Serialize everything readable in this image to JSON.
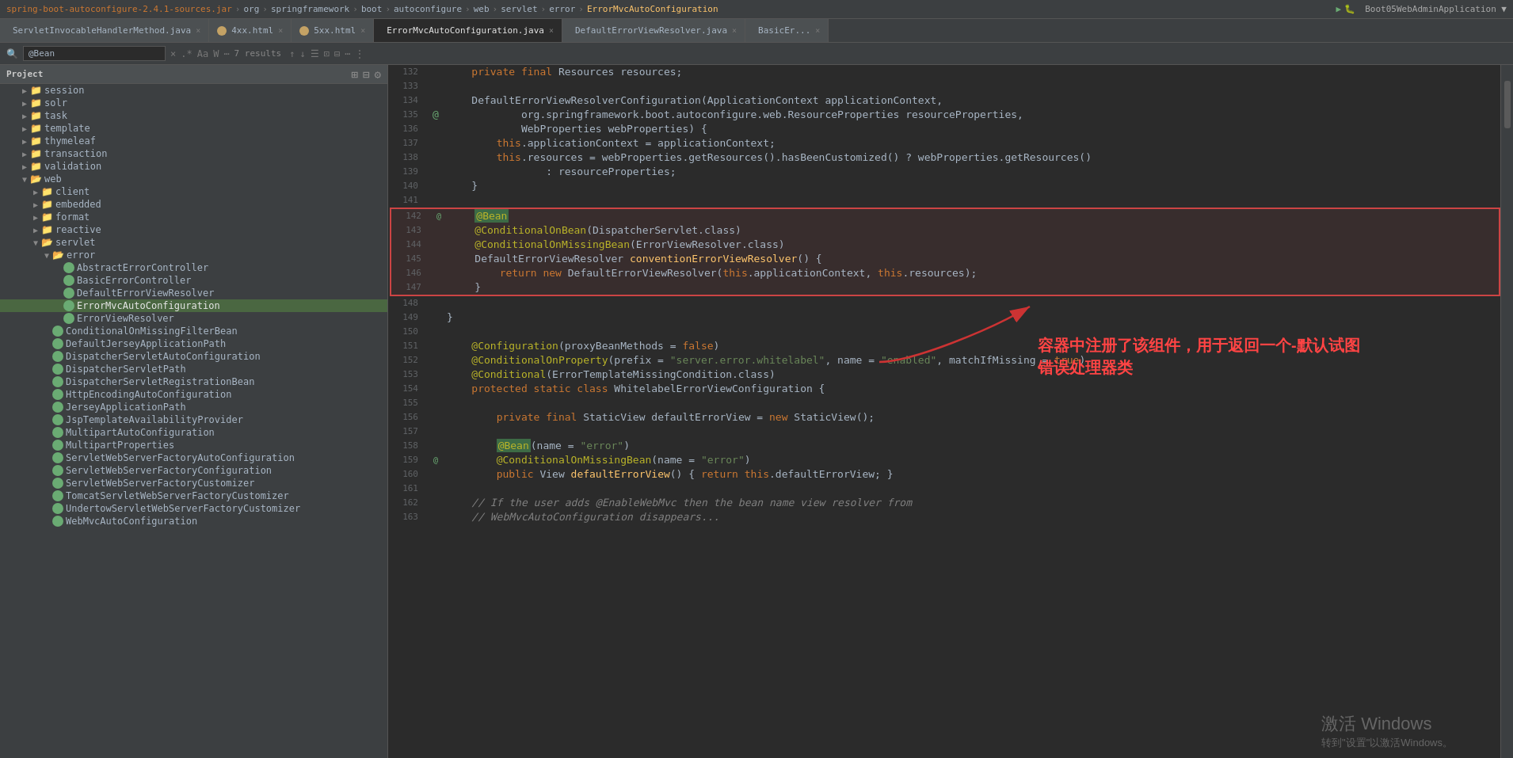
{
  "breadcrumb": {
    "items": [
      "spring-boot-autoconfigure-2.4.1-sources.jar",
      "org",
      "springframework",
      "boot",
      "autoconfigure",
      "web",
      "servlet",
      "error",
      "ErrorMvcAutoConfiguration"
    ],
    "separator": "›"
  },
  "tabs": [
    {
      "label": "ServletInvocableHandlerMethod.java",
      "icon": "orange",
      "active": false
    },
    {
      "label": "4xx.html",
      "icon": "orange",
      "active": false
    },
    {
      "label": "5xx.html",
      "icon": "orange",
      "active": false
    },
    {
      "label": "ErrorMvcAutoConfiguration.java",
      "icon": "green",
      "active": true
    },
    {
      "label": "DefaultErrorViewResolver.java",
      "icon": "green",
      "active": false
    },
    {
      "label": "BasicEr...",
      "icon": "green",
      "active": false
    }
  ],
  "search": {
    "query": "@Bean",
    "results": "7 results"
  },
  "sidebar": {
    "title": "Project",
    "tree_items": [
      {
        "label": "session",
        "type": "folder",
        "indent": 1,
        "expanded": false
      },
      {
        "label": "solr",
        "type": "folder",
        "indent": 1,
        "expanded": false
      },
      {
        "label": "task",
        "type": "folder",
        "indent": 1,
        "expanded": false
      },
      {
        "label": "template",
        "type": "folder",
        "indent": 1,
        "expanded": false
      },
      {
        "label": "thymeleaf",
        "type": "folder",
        "indent": 1,
        "expanded": false
      },
      {
        "label": "transaction",
        "type": "folder",
        "indent": 1,
        "expanded": false
      },
      {
        "label": "validation",
        "type": "folder",
        "indent": 1,
        "expanded": false
      },
      {
        "label": "web",
        "type": "folder",
        "indent": 1,
        "expanded": true
      },
      {
        "label": "client",
        "type": "folder",
        "indent": 2,
        "expanded": false
      },
      {
        "label": "embedded",
        "type": "folder",
        "indent": 2,
        "expanded": false
      },
      {
        "label": "format",
        "type": "folder",
        "indent": 2,
        "expanded": false
      },
      {
        "label": "reactive",
        "type": "folder",
        "indent": 2,
        "expanded": false
      },
      {
        "label": "servlet",
        "type": "folder",
        "indent": 2,
        "expanded": true
      },
      {
        "label": "error",
        "type": "folder",
        "indent": 3,
        "expanded": true
      },
      {
        "label": "AbstractErrorController",
        "type": "file",
        "indent": 4,
        "icon": "green"
      },
      {
        "label": "BasicErrorController",
        "type": "file",
        "indent": 4,
        "icon": "green"
      },
      {
        "label": "DefaultErrorViewResolver",
        "type": "file",
        "indent": 4,
        "icon": "green"
      },
      {
        "label": "ErrorMvcAutoConfiguration",
        "type": "file",
        "indent": 4,
        "icon": "green",
        "selected": true
      },
      {
        "label": "ErrorViewResolver",
        "type": "file",
        "indent": 4,
        "icon": "green"
      },
      {
        "label": "ConditionalOnMissingFilterBean",
        "type": "file",
        "indent": 3,
        "icon": "green"
      },
      {
        "label": "DefaultJerseyApplicationPath",
        "type": "file",
        "indent": 3,
        "icon": "green"
      },
      {
        "label": "DispatcherServletAutoConfiguration",
        "type": "file",
        "indent": 3,
        "icon": "green"
      },
      {
        "label": "DispatcherServletPath",
        "type": "file",
        "indent": 3,
        "icon": "green"
      },
      {
        "label": "DispatcherServletRegistrationBean",
        "type": "file",
        "indent": 3,
        "icon": "green"
      },
      {
        "label": "HttpEncodingAutoConfiguration",
        "type": "file",
        "indent": 3,
        "icon": "green"
      },
      {
        "label": "JerseyApplicationPath",
        "type": "file",
        "indent": 3,
        "icon": "green"
      },
      {
        "label": "JspTemplateAvailabilityProvider",
        "type": "file",
        "indent": 3,
        "icon": "green"
      },
      {
        "label": "MultipartAutoConfiguration",
        "type": "file",
        "indent": 3,
        "icon": "green"
      },
      {
        "label": "MultipartProperties",
        "type": "file",
        "indent": 3,
        "icon": "green"
      },
      {
        "label": "ServletWebServerFactoryAutoConfiguration",
        "type": "file",
        "indent": 3,
        "icon": "green"
      },
      {
        "label": "ServletWebServerFactoryConfiguration",
        "type": "file",
        "indent": 3,
        "icon": "green"
      },
      {
        "label": "ServletWebServerFactoryCustomizer",
        "type": "file",
        "indent": 3,
        "icon": "green"
      },
      {
        "label": "TomcatServletWebServerFactoryCustomizer",
        "type": "file",
        "indent": 3,
        "icon": "green"
      },
      {
        "label": "UndertowServletWebServerFactoryCustomizer",
        "type": "file",
        "indent": 3,
        "icon": "green"
      },
      {
        "label": "WebMvcAutoConfiguration",
        "type": "file",
        "indent": 3,
        "icon": "green"
      }
    ]
  },
  "code_lines": [
    {
      "num": 132,
      "content": "    private final Resources resources;"
    },
    {
      "num": 133,
      "content": ""
    },
    {
      "num": 134,
      "content": "    DefaultErrorViewResolverConfiguration(ApplicationContext applicationContext,"
    },
    {
      "num": 135,
      "content": "            org.springframework.boot.autoconfigure.web.ResourceProperties resourceProperties,",
      "has_marker": true
    },
    {
      "num": 136,
      "content": "            WebProperties webProperties) {"
    },
    {
      "num": 137,
      "content": "        this.applicationContext = applicationContext;"
    },
    {
      "num": 138,
      "content": "        this.resources = webProperties.getResources().hasBeenCustomized() ? webProperties.getResources()"
    },
    {
      "num": 139,
      "content": "                : resourceProperties;"
    },
    {
      "num": 140,
      "content": "    }"
    },
    {
      "num": 141,
      "content": ""
    },
    {
      "num": 142,
      "content": "    @Bean",
      "highlight": true,
      "red_box_start": true
    },
    {
      "num": 143,
      "content": "    @ConditionalOnBean(DispatcherServlet.class)"
    },
    {
      "num": 144,
      "content": "    @ConditionalOnMissingBean(ErrorViewResolver.class)"
    },
    {
      "num": 145,
      "content": "    DefaultErrorViewResolver conventionErrorViewResolver() {"
    },
    {
      "num": 146,
      "content": "        return new DefaultErrorViewResolver(this.applicationContext, this.resources);"
    },
    {
      "num": 147,
      "content": "    }",
      "red_box_end": true
    },
    {
      "num": 148,
      "content": ""
    },
    {
      "num": 149,
      "content": "}"
    },
    {
      "num": 150,
      "content": ""
    },
    {
      "num": 151,
      "content": "@Configuration(proxyBeanMethods = false)"
    },
    {
      "num": 152,
      "content": "@ConditionalOnProperty(prefix = \"server.error.whitelabel\", name = \"enabled\", matchIfMissing = true)"
    },
    {
      "num": 153,
      "content": "@Conditional(ErrorTemplateMissingCondition.class)"
    },
    {
      "num": 154,
      "content": "protected static class WhitelabelErrorViewConfiguration {"
    },
    {
      "num": 155,
      "content": ""
    },
    {
      "num": 156,
      "content": "    private final StaticView defaultErrorView = new StaticView();"
    },
    {
      "num": 157,
      "content": ""
    },
    {
      "num": 158,
      "content": "    @Bean(name = \"error\")",
      "has_bean_marker": true
    },
    {
      "num": 159,
      "content": "    @ConditionalOnMissingBean(name = \"error\")"
    },
    {
      "num": 160,
      "content": "    public View defaultErrorView() { return this.defaultErrorView; }"
    },
    {
      "num": 161,
      "content": ""
    },
    {
      "num": 162,
      "content": "    // If the user adds @EnableWebMvc then the bean name view resolver from"
    },
    {
      "num": 163,
      "content": "    // WebMvcAutoConfiguration disappears..."
    }
  ],
  "annotation": {
    "text_line1": "容器中注册了该组件，用于返回一个-默认试图",
    "text_line2": "错误处理器类"
  },
  "colors": {
    "background": "#2b2b2b",
    "sidebar_bg": "#3c3f41",
    "selected": "#4a6741",
    "red_box": "#cc3333",
    "annotation_color": "#ff4444"
  }
}
